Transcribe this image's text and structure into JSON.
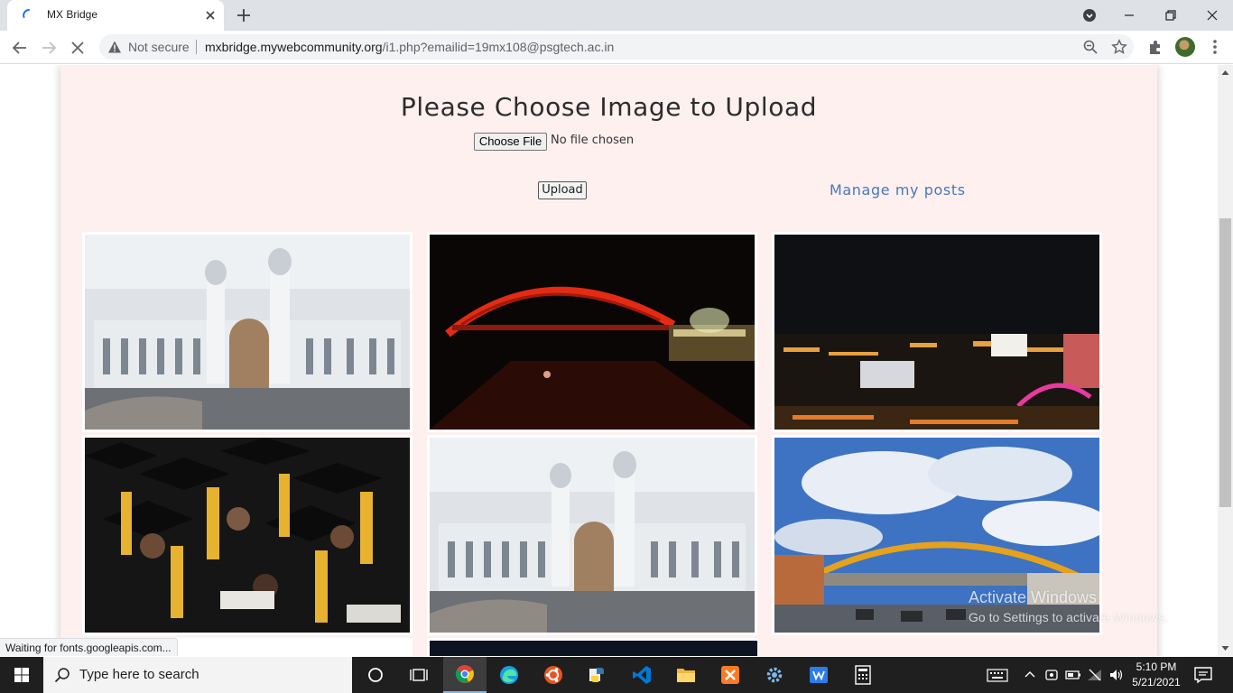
{
  "browser": {
    "tab_title": "MX Bridge",
    "security_label": "Not secure",
    "url_host": "mxbridge.mywebcommunity.org",
    "url_path": "/i1.php?emailid=19mx108@psgtech.ac.in",
    "status_text": "Waiting for fonts.googleapis.com..."
  },
  "page": {
    "title": "Please Choose Image to Upload",
    "choose_file_label": "Choose File",
    "no_file_text": "No file chosen",
    "upload_label": "Upload",
    "manage_posts_label": "Manage my posts",
    "images": [
      {
        "subject": "college-building-day"
      },
      {
        "subject": "red-arch-bridge-night"
      },
      {
        "subject": "city-skyline-night"
      },
      {
        "subject": "graduation-ceremony"
      },
      {
        "subject": "college-building-day"
      },
      {
        "subject": "yellow-arch-bridge-day"
      },
      {
        "subject": "dark-night-photo"
      }
    ]
  },
  "watermark": {
    "title": "Activate Windows",
    "subtitle": "Go to Settings to activate Windows."
  },
  "taskbar": {
    "search_placeholder": "Type here to search",
    "time": "5:10 PM",
    "date": "5/21/2021",
    "apps": [
      "task-view",
      "chrome",
      "edge",
      "ubuntu",
      "python",
      "vscode",
      "file-explorer",
      "xampp",
      "settings",
      "wps-writer",
      "calculator"
    ]
  },
  "colors": {
    "panel_bg": "#fdf0ef",
    "link": "#4a78b9",
    "taskbar": "#1f1f1f"
  }
}
